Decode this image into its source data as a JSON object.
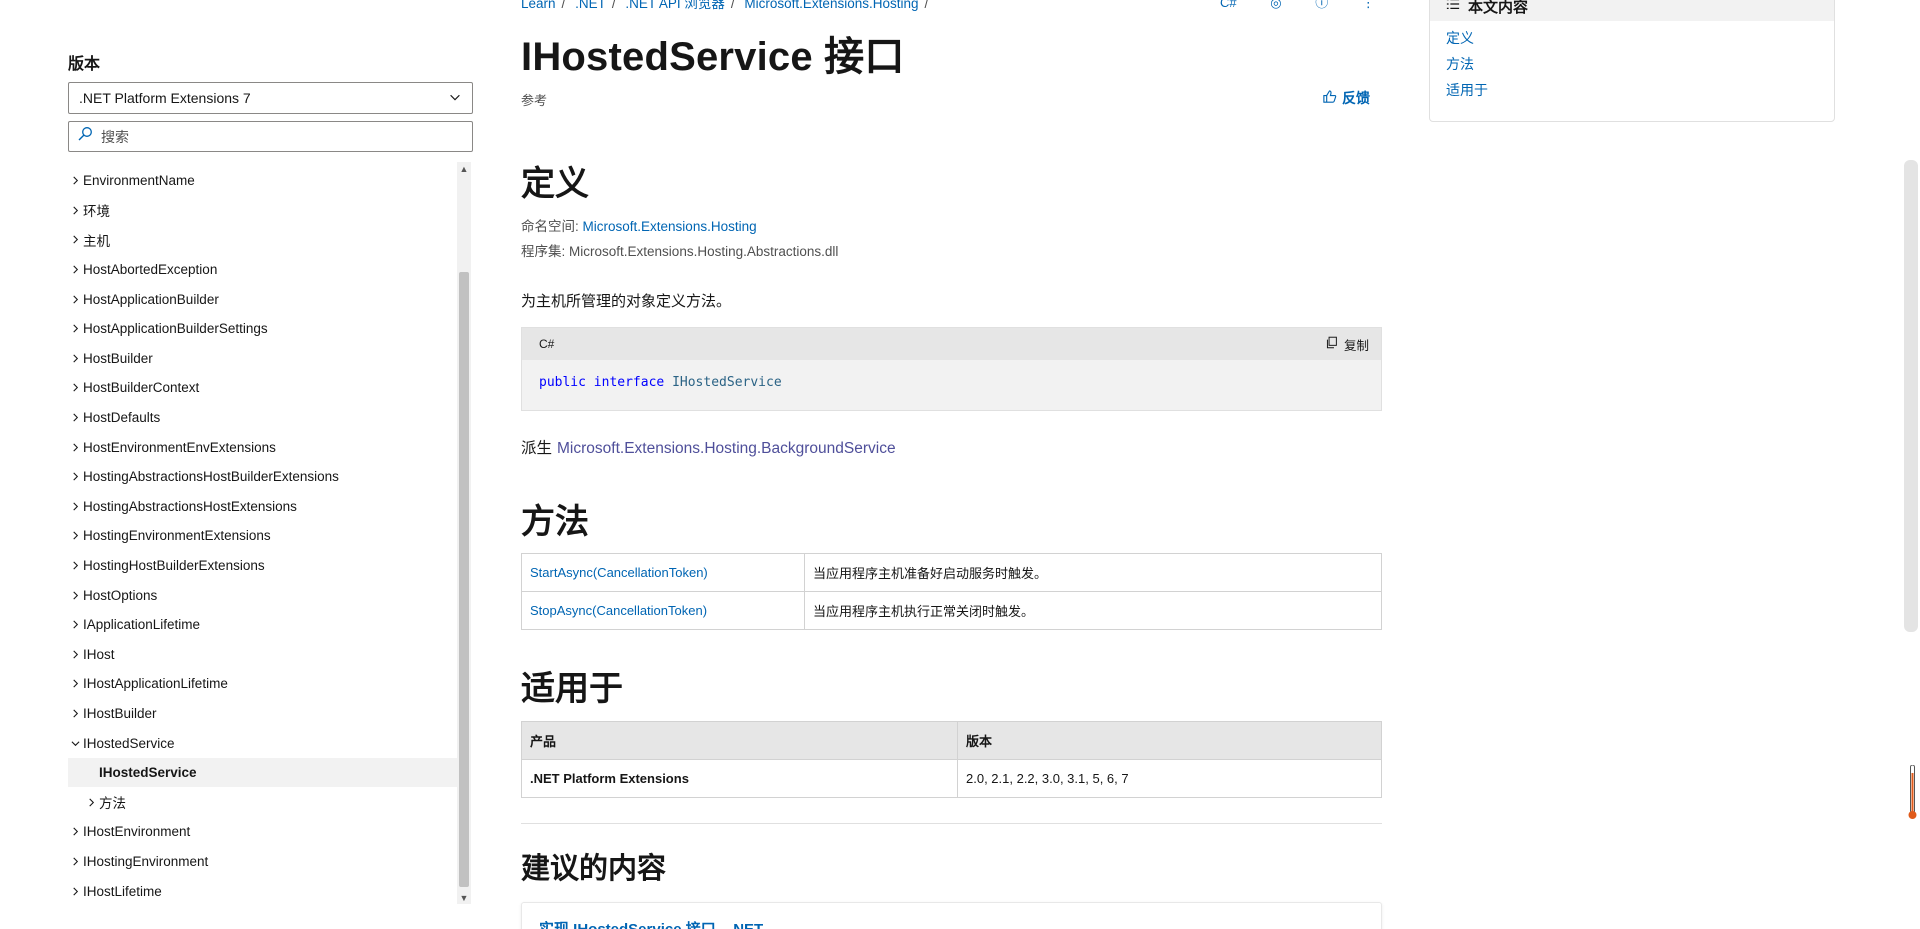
{
  "sidebar": {
    "version_label": "版本",
    "version_selected": ".NET Platform Extensions 7",
    "search_placeholder": "搜索",
    "tree": [
      {
        "label": "EnvironmentName"
      },
      {
        "label": "环境"
      },
      {
        "label": "主机"
      },
      {
        "label": "HostAbortedException"
      },
      {
        "label": "HostApplicationBuilder"
      },
      {
        "label": "HostApplicationBuilderSettings"
      },
      {
        "label": "HostBuilder"
      },
      {
        "label": "HostBuilderContext"
      },
      {
        "label": "HostDefaults"
      },
      {
        "label": "HostEnvironmentEnvExtensions"
      },
      {
        "label": "HostingAbstractionsHostBuilderExtensions"
      },
      {
        "label": "HostingAbstractionsHostExtensions"
      },
      {
        "label": "HostingEnvironmentExtensions"
      },
      {
        "label": "HostingHostBuilderExtensions"
      },
      {
        "label": "HostOptions"
      },
      {
        "label": "IApplicationLifetime"
      },
      {
        "label": "IHost"
      },
      {
        "label": "IHostApplicationLifetime"
      },
      {
        "label": "IHostBuilder"
      },
      {
        "label": "IHostedService"
      },
      {
        "label": "IHostedService"
      },
      {
        "label": "方法"
      },
      {
        "label": "IHostEnvironment"
      },
      {
        "label": "IHostingEnvironment"
      },
      {
        "label": "IHostLifetime"
      }
    ]
  },
  "breadcrumb": [
    "Learn",
    ".NET",
    ".NET API 浏览器",
    "Microsoft.Extensions.Hosting"
  ],
  "top_actions": [
    "C#"
  ],
  "main": {
    "title": "IHostedService 接口",
    "ref_label": "参考",
    "feedback_label": "反馈",
    "definition_heading": "定义",
    "namespace_label": "命名空间:",
    "namespace_value": "Microsoft.Extensions.Hosting",
    "assembly_label": "程序集:",
    "assembly_value": "Microsoft.Extensions.Hosting.Abstractions.dll",
    "description": "为主机所管理的对象定义方法。",
    "code": {
      "lang": "C#",
      "copy_label": "复制",
      "kw1": "public",
      "kw2": "interface",
      "type": "IHostedService"
    },
    "derived_label": "派生",
    "derived_value": "Microsoft.Extensions.Hosting.BackgroundService",
    "methods_heading": "方法",
    "methods": [
      {
        "name": "StartAsync(CancellationToken)",
        "desc": "当应用程序主机准备好启动服务时触发。"
      },
      {
        "name": "StopAsync(CancellationToken)",
        "desc": "当应用程序主机执行正常关闭时触发。"
      }
    ],
    "applies_heading": "适用于",
    "applies_headers": {
      "product": "产品",
      "version": "版本"
    },
    "applies_rows": [
      {
        "product": ".NET Platform Extensions",
        "versions": "2.0, 2.1, 2.2, 3.0, 3.1, 5, 6, 7"
      }
    ],
    "recommended_heading": "建议的内容",
    "recommended_first": "实现 IHostedService 接口 - .NET"
  },
  "toc": {
    "title": "本文内容",
    "links": [
      "定义",
      "方法",
      "适用于"
    ]
  },
  "colors": {
    "link": "#0065b3",
    "active_bg": "#f2f2f2",
    "code_bg": "#f2f2f2"
  }
}
